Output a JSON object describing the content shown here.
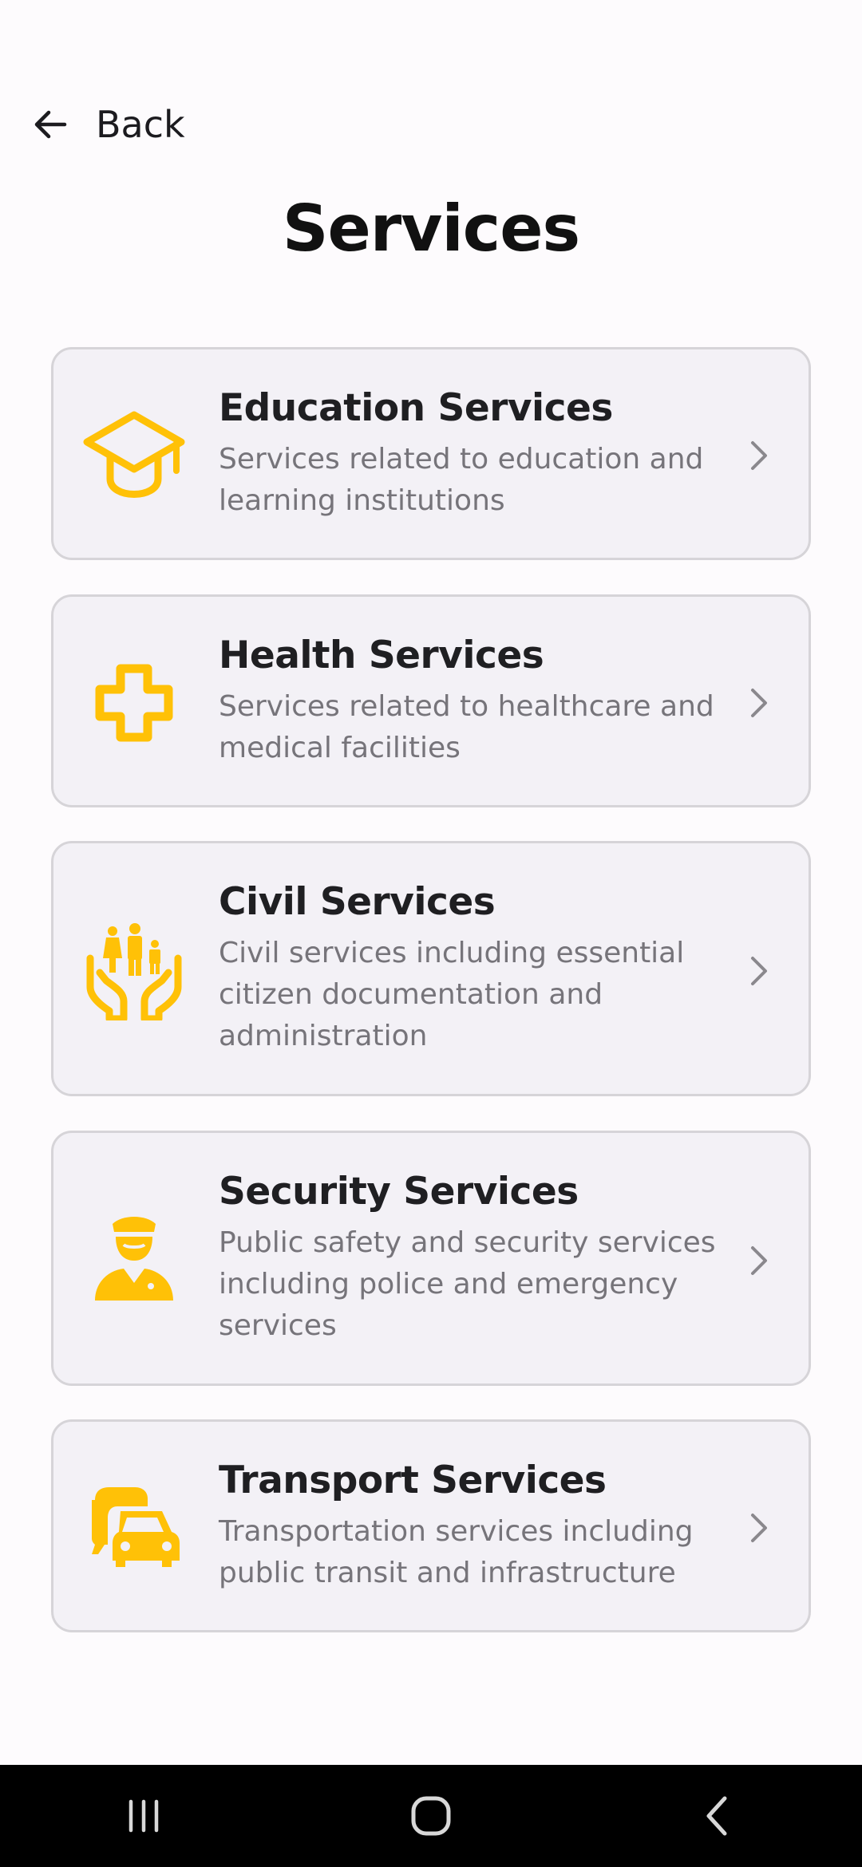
{
  "header": {
    "back_label": "Back",
    "title": "Services"
  },
  "colors": {
    "accent": "#FFC107",
    "background": "#FDFBFD",
    "card_background": "#F3F1F6",
    "card_border": "#D6D4D8",
    "description": "#76747A"
  },
  "services": [
    {
      "title": "Education Services",
      "description": "Services related to education and learning institutions",
      "icon": "graduation-cap-icon"
    },
    {
      "title": "Health Services",
      "description": "Services related to healthcare and medical facilities",
      "icon": "medical-cross-icon"
    },
    {
      "title": "Civil Services",
      "description": "Civil services including essential citizen documentation and administration",
      "icon": "family-hands-icon"
    },
    {
      "title": "Security Services",
      "description": "Public safety and security services including police and emergency services",
      "icon": "police-officer-icon"
    },
    {
      "title": "Transport Services",
      "description": "Transportation services including public transit and infrastructure",
      "icon": "bus-car-icon"
    }
  ],
  "nav": {
    "recents_icon": "recents-icon",
    "home_icon": "home-icon",
    "back_icon": "nav-back-icon"
  }
}
